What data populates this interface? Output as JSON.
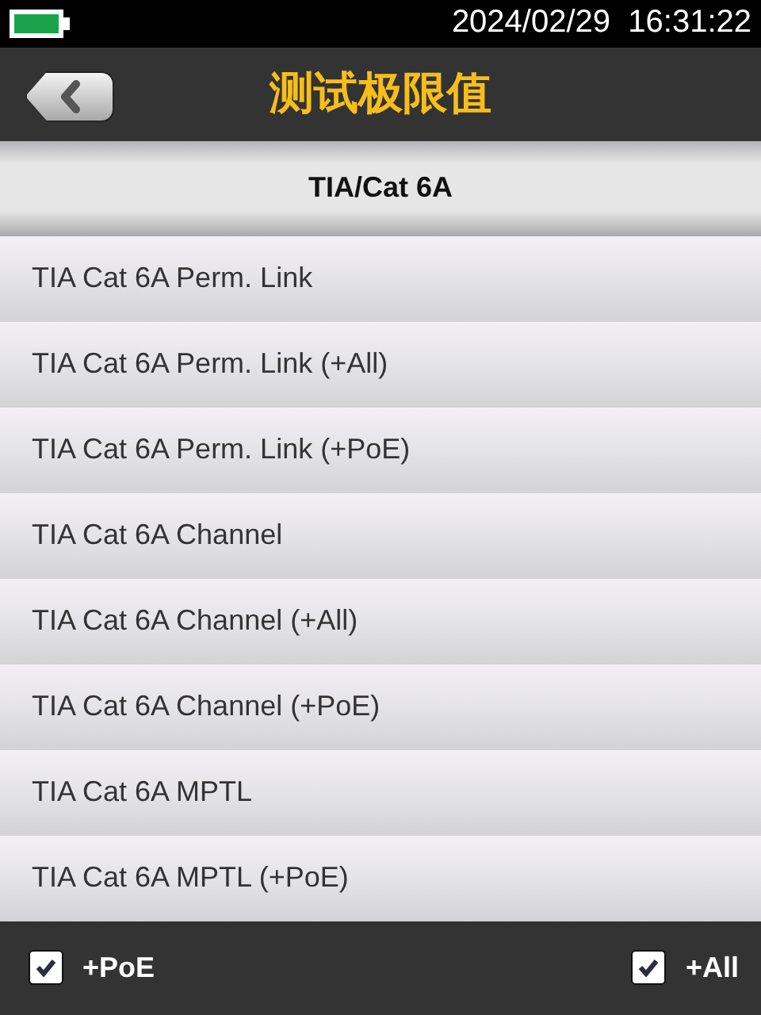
{
  "status_bar": {
    "datetime": "2024/02/29  16:31:22"
  },
  "header": {
    "title": "测试极限值"
  },
  "group": {
    "title": "TIA/Cat 6A"
  },
  "items": [
    {
      "label": "TIA Cat 6A Perm. Link"
    },
    {
      "label": "TIA Cat 6A Perm. Link (+All)"
    },
    {
      "label": "TIA Cat 6A Perm. Link (+PoE)"
    },
    {
      "label": "TIA Cat 6A Channel"
    },
    {
      "label": "TIA Cat 6A Channel (+All)"
    },
    {
      "label": "TIA Cat 6A Channel (+PoE)"
    },
    {
      "label": "TIA Cat 6A MPTL"
    },
    {
      "label": "TIA Cat 6A MPTL (+PoE)"
    }
  ],
  "footer": {
    "options": [
      {
        "label": "+PoE",
        "checked": true
      },
      {
        "label": "+All",
        "checked": true
      }
    ]
  }
}
